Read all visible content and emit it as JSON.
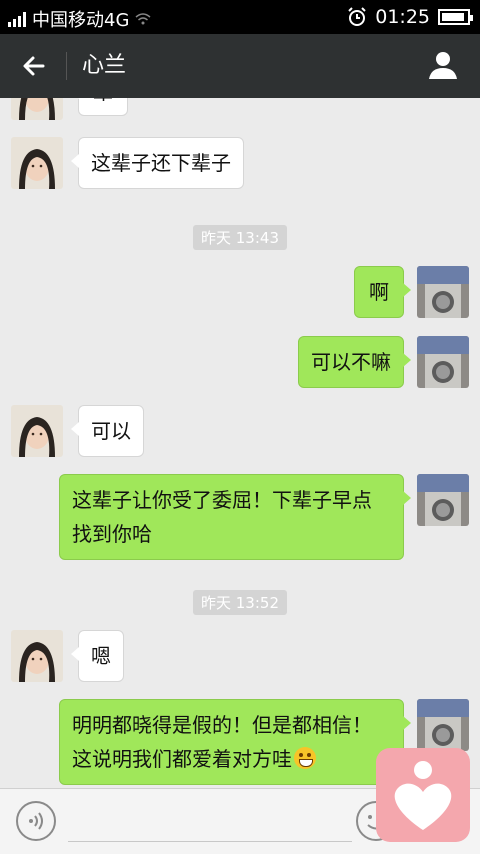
{
  "status_bar": {
    "carrier": "中国移动4G",
    "time": "01:25"
  },
  "title_bar": {
    "title": "心兰"
  },
  "input_bar": {
    "placeholder": ""
  },
  "messages": [
    {
      "type": "in",
      "text": "辈"
    },
    {
      "type": "in",
      "text": "这辈子还下辈子"
    },
    {
      "type": "time",
      "text": "昨天 13:43"
    },
    {
      "type": "out",
      "text": "啊"
    },
    {
      "type": "out",
      "text": "可以不嘛"
    },
    {
      "type": "in",
      "text": "可以"
    },
    {
      "type": "out",
      "line1": "这辈子让你受了委屈！下辈子早点",
      "line2": "找到你哈"
    },
    {
      "type": "time",
      "text": "昨天 13:52"
    },
    {
      "type": "in",
      "text": "嗯"
    },
    {
      "type": "out",
      "line1": "明明都晓得是假的！但是都相信！",
      "line2": "这说明我们都爱着对方哇"
    }
  ],
  "colors": {
    "title_bar_bg": "#2e3132",
    "sent_bubble": "#a0e75a",
    "received_bubble": "#ffffff",
    "chat_bg": "#ebebeb",
    "app_badge": "#f4a7ad"
  },
  "icons": [
    "back-arrow-icon",
    "profile-icon",
    "voice-icon",
    "emoji-icon",
    "grin-emoji-icon",
    "heart-app-icon",
    "alarm-icon",
    "signal-icon",
    "battery-icon"
  ]
}
